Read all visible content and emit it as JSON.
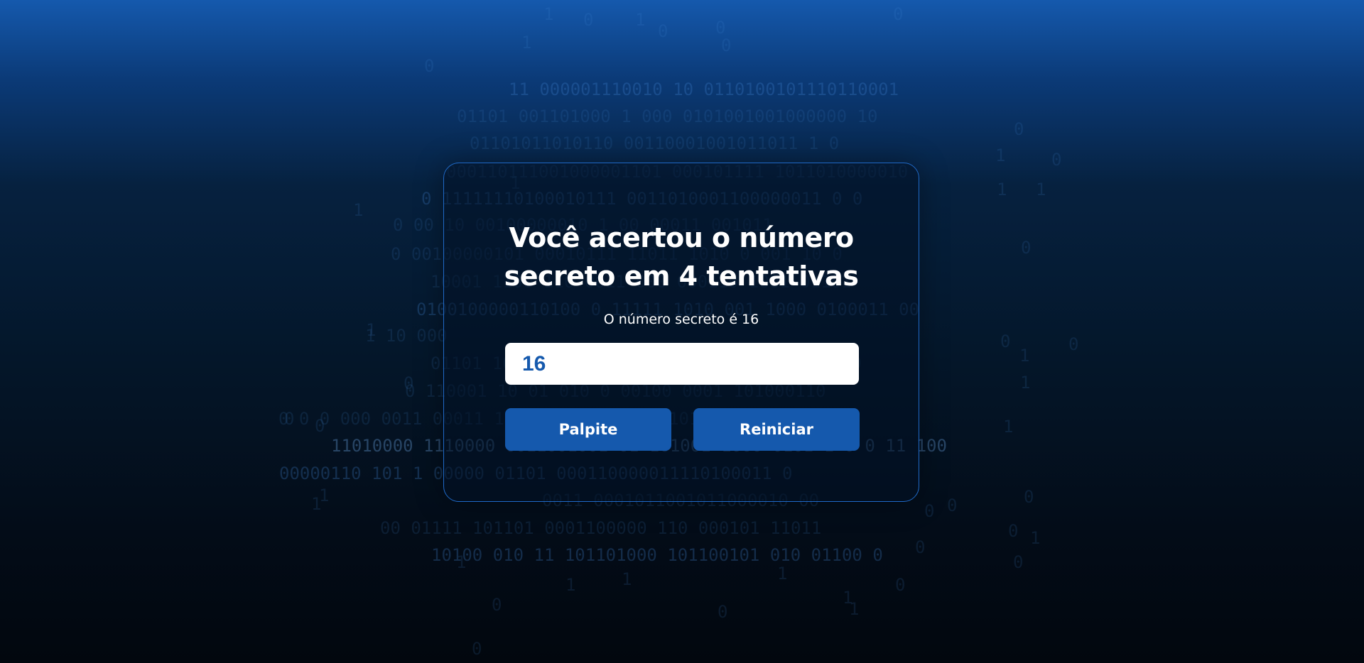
{
  "background": {
    "binary_rows": [
      "11 000001110010 10 0110100101110110001",
      "01101 001101000 1   000 0101001001000000 10",
      "01101011010110   00110001001011011 1 0",
      "000110111001000001101 000101111  1011010000010",
      "0 11111110100010111 0011010001100000011 0 0",
      "0   00 10 00100000010 1 00 00011   001011",
      "0  00100000101 00010111 11011 1010  0   001 10 0",
      "10001 1100 110 0011 000 000110 1001 01101",
      "0100100000110100 0  11111 1010 001 1000 0100011 00",
      "1  10 000",
      "01101 100 1 0001 001 0100 011 11 111 01000",
      "0  110001 10 01 010 0 00100 0001  101000110",
      "0  0  0 000   0011 00011  101 10 0 0 11000 1010",
      "11010000 1110000 0011001001 01 101001 1000 0101 1 0 0 11 100",
      "00000110   101 1 00000 01101  000110000011110100011 0",
      "0011 0001011001011000010 00",
      "00 01111   101101 0001100000 110 000101 11011",
      "10100 010 11 101101000 101100101 010 01100 0"
    ],
    "scatter_digits": [
      "1",
      "0",
      "1",
      "0",
      "0",
      "0",
      "1",
      "0",
      "0",
      "1",
      "1",
      "0",
      "1",
      "1",
      "1",
      "0",
      "0",
      "1",
      "1",
      "0",
      "1",
      "0",
      "1",
      "1",
      "1",
      "0",
      "0",
      "0",
      "1",
      "1",
      "0",
      "0",
      "0",
      "1",
      "1",
      "0",
      "0",
      "1",
      "0",
      "1",
      "0",
      "0",
      "1",
      "0",
      "0"
    ]
  },
  "card": {
    "title_line1": "Você acertou o número",
    "title_line2": "secreto em 4 tentativas",
    "subtitle": "O número secreto é 16",
    "input_value": "16",
    "guess_button_label": "Palpite",
    "restart_button_label": "Reiniciar"
  },
  "colors": {
    "accent": "#1559ad",
    "card_border": "#1f69c7",
    "text": "#ffffff"
  }
}
